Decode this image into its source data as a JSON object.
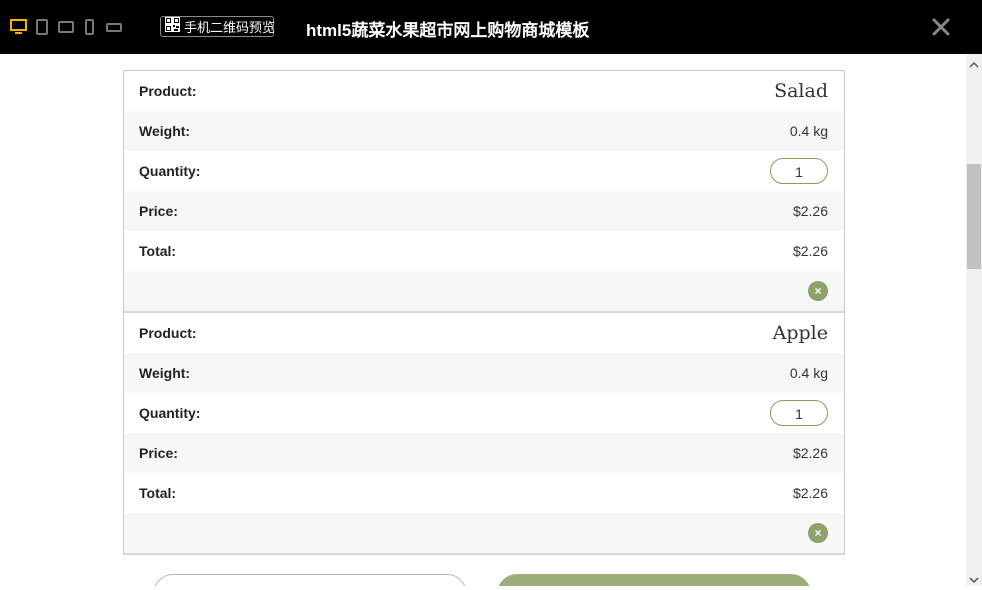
{
  "toolbar": {
    "devices": [
      "desktop-icon",
      "tablet-portrait-icon",
      "tablet-landscape-icon",
      "phone-portrait-icon",
      "phone-landscape-icon"
    ],
    "qr_label": "手机二维码预览",
    "title": "html5蔬菜水果超市网上购物商城模板"
  },
  "labels": {
    "product": "Product:",
    "weight": "Weight:",
    "quantity": "Quantity:",
    "price": "Price:",
    "total": "Total:",
    "remove": "×"
  },
  "cart": {
    "items": [
      {
        "product": "Salad",
        "weight": "0.4 kg",
        "quantity": "1",
        "price": "$2.26",
        "total": "$2.26"
      },
      {
        "product": "Apple",
        "weight": "0.4 kg",
        "quantity": "1",
        "price": "$2.26",
        "total": "$2.26"
      }
    ]
  },
  "colors": {
    "accent": "#8ea26a",
    "button_green": "#9daf78",
    "topbar": "#000000",
    "active_device": "#f0b400"
  }
}
